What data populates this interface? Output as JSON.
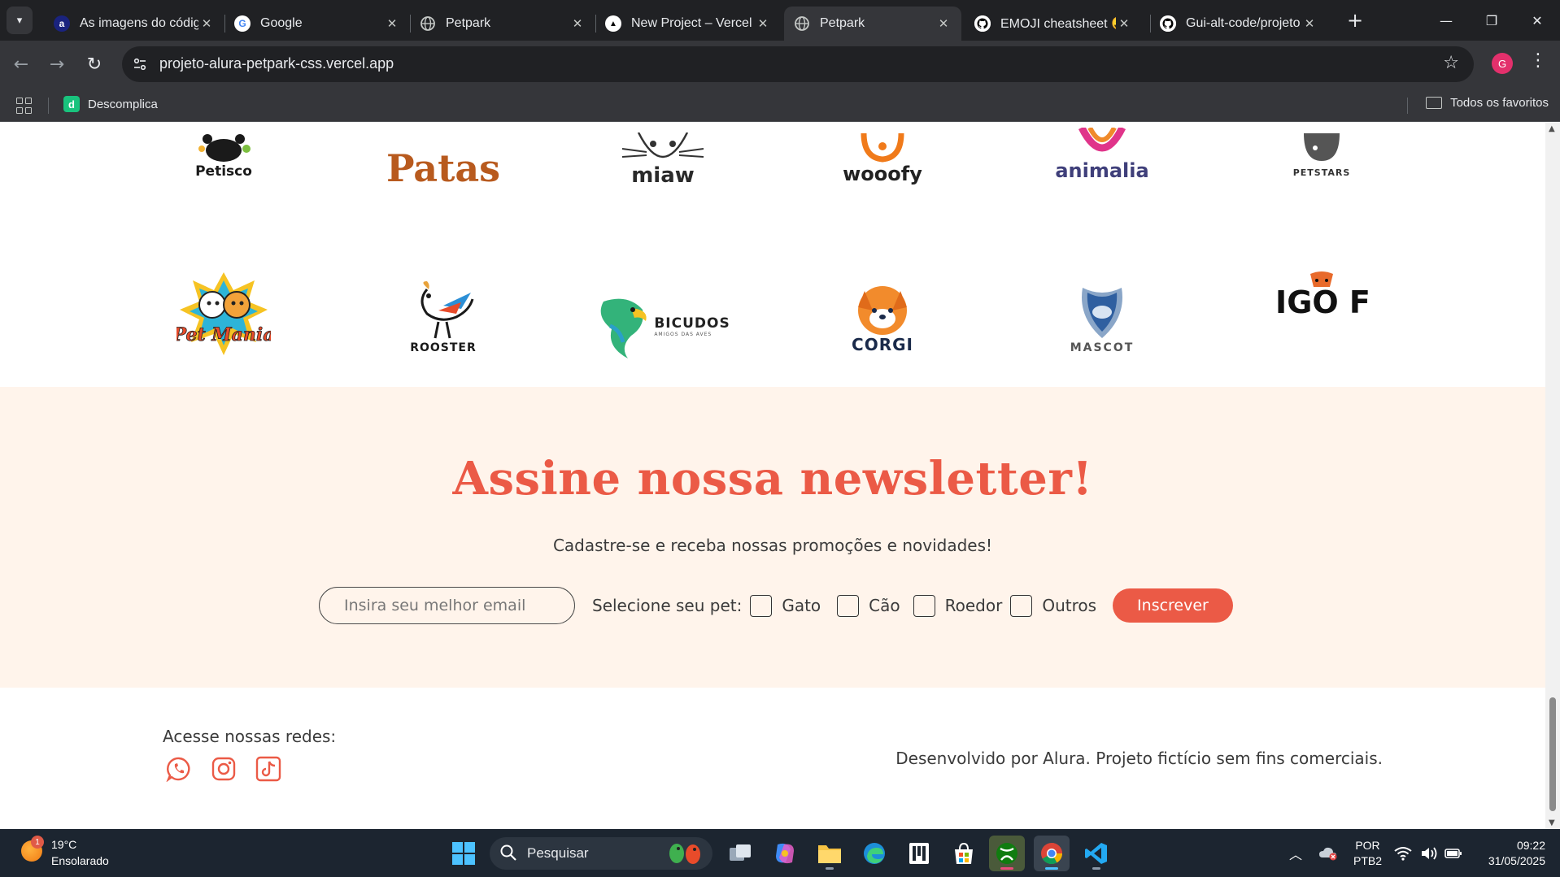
{
  "browser": {
    "tabs": [
      {
        "title": "As imagens do códig",
        "favicon": "a",
        "favicon_color": "#1a237e",
        "favicon_text": "#ffffff",
        "active": false
      },
      {
        "title": "Google",
        "favicon": "G",
        "favicon_color": "#ffffff",
        "favicon_text": "#4285f4",
        "active": false
      },
      {
        "title": "Petpark",
        "favicon": "globe-icon",
        "favicon_color": "#5f6368",
        "favicon_text": "#ffffff",
        "active": false
      },
      {
        "title": "New Project – Vercel",
        "favicon": "▲",
        "favicon_color": "#ffffff",
        "favicon_text": "#000000",
        "active": false
      },
      {
        "title": "Petpark",
        "favicon": "globe-icon",
        "favicon_color": "#5f6368",
        "favicon_text": "#ffffff",
        "active": true
      },
      {
        "title": "EMOJI cheatsheet 😛",
        "favicon": "github-icon",
        "favicon_color": "#ffffff",
        "favicon_text": "#000000",
        "active": false
      },
      {
        "title": "Gui-alt-code/projeto",
        "favicon": "github-icon",
        "favicon_color": "#ffffff",
        "favicon_text": "#000000",
        "active": false
      }
    ],
    "url": "projeto-alura-petpark-css.vercel.app",
    "profile_initial": "G",
    "bookmarks": [
      {
        "label": "Descomplica",
        "icon": "d"
      }
    ],
    "all_bookmarks_label": "Todos os favoritos"
  },
  "brands": {
    "row1": [
      {
        "name": "Petisco",
        "color": "#1a1a1a",
        "accent": "#1a1a1a"
      },
      {
        "name": "Patas",
        "color": "#b85a1e",
        "accent": "#c46a28"
      },
      {
        "name": "miaw",
        "color": "#2a2a2a",
        "accent": "#444444"
      },
      {
        "name": "wooofy",
        "color": "#222222",
        "accent": "#f07a1a"
      },
      {
        "name": "animalia",
        "color": "#3f3f7a",
        "accent": "#e0348a"
      },
      {
        "name": "PETSTARS",
        "color": "#333333",
        "accent": "#555555"
      }
    ],
    "row2": [
      {
        "name": "Pet Mania",
        "color": "#e84b2a",
        "accent": "#f6c323"
      },
      {
        "name": "ROOSTER",
        "color": "#1a1a1a",
        "accent": "#2c8fd6"
      },
      {
        "name": "BICUDOS",
        "color": "#222222",
        "accent": "#33b37a",
        "tagline": "AMIGOS DAS AVES"
      },
      {
        "name": "CORGI",
        "color": "#1a2a4a",
        "accent": "#f28b2c"
      },
      {
        "name": "MASCOT",
        "color": "#555555",
        "accent": "#2f5fa0"
      },
      {
        "name": "AMIGO FIEL",
        "color": "#111111",
        "accent": "#e86a2b"
      }
    ]
  },
  "newsletter": {
    "title": "Assine nossa newsletter!",
    "subtitle": "Cadastre-se e receba nossas promoções e novidades!",
    "email_placeholder": "Insira seu melhor email",
    "pet_label": "Selecione seu pet:",
    "pet_options": [
      "Gato",
      "Cão",
      "Roedor",
      "Outros"
    ],
    "button": "Inscrever",
    "accent_color": "#eb5a46",
    "background": "#fff4eb"
  },
  "footer": {
    "social_label": "Acesse nossas redes:",
    "social": [
      "whatsapp-icon",
      "instagram-icon",
      "tiktok-icon"
    ],
    "credit": "Desenvolvido por Alura. Projeto fictício sem fins comerciais."
  },
  "taskbar": {
    "weather_temp": "19°C",
    "weather_desc": "Ensolarado",
    "weather_badge": "1",
    "search_placeholder": "Pesquisar",
    "lang_line1": "POR",
    "lang_line2": "PTB2",
    "time": "09:22",
    "date": "31/05/2025"
  }
}
